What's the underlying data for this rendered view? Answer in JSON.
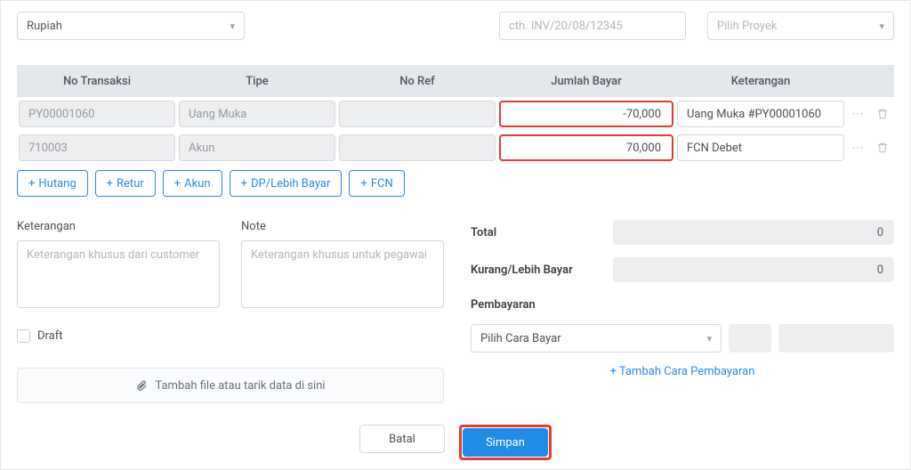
{
  "top": {
    "currency": "Rupiah",
    "ref_placeholder": "cth. INV/20/08/12345",
    "project_placeholder": "Pilih Proyek"
  },
  "grid": {
    "headers": {
      "no_transaksi": "No Transaksi",
      "tipe": "Tipe",
      "no_ref": "No Ref",
      "jumlah_bayar": "Jumlah Bayar",
      "keterangan": "Keterangan"
    },
    "rows": [
      {
        "no": "PY00001060",
        "tipe": "Uang Muka",
        "ref": "",
        "jumlah": "-70,000",
        "ket": "Uang Muka #PY00001060"
      },
      {
        "no": "710003",
        "tipe": "Akun",
        "ref": "",
        "jumlah": "70,000",
        "ket": "FCN Debet"
      }
    ],
    "add": {
      "hutang": "Hutang",
      "retur": "Retur",
      "akun": "Akun",
      "dp": "DP/Lebih Bayar",
      "fcn": "FCN"
    }
  },
  "lower": {
    "keterangan_label": "Keterangan",
    "keterangan_placeholder": "Keterangan khusus dari customer",
    "note_label": "Note",
    "note_placeholder": "Keterangan khusus untuk pegawai",
    "draft": "Draft",
    "upload": "Tambah file atau tarik data di sini"
  },
  "summary": {
    "total_label": "Total",
    "total_value": "0",
    "kurang_label": "Kurang/Lebih Bayar",
    "kurang_value": "0",
    "pembayaran_label": "Pembayaran",
    "pay_select": "Pilih Cara Bayar",
    "add_pay": "Tambah Cara Pembayaran"
  },
  "footer": {
    "batal": "Batal",
    "simpan": "Simpan"
  }
}
